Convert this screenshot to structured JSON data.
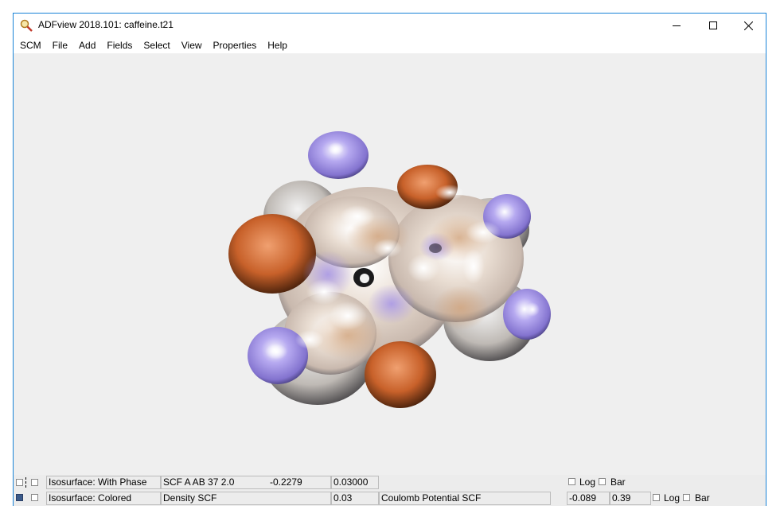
{
  "window": {
    "title": "ADFview 2018.101: caffeine.t21",
    "controls": [
      "minimize",
      "maximize",
      "close"
    ]
  },
  "menu": [
    "SCM",
    "File",
    "Add",
    "Fields",
    "Select",
    "View",
    "Properties",
    "Help"
  ],
  "viewport": {
    "background": "#efefef",
    "object": "caffeine isosurface"
  },
  "status_rows": [
    {
      "type_label": "Isosurface: With Phase",
      "field_label": "SCF A AB 37 2.0",
      "field_value": "-0.2279",
      "iso_value": "0.03000",
      "color_field": "",
      "min_value": "",
      "max_value": "",
      "log_label": "Log",
      "bar_label": "Bar"
    },
    {
      "type_label": "Isosurface: Colored",
      "field_label": "Density SCF",
      "field_value": "",
      "iso_value": "0.03",
      "color_field": "Coulomb Potential SCF",
      "min_value": "-0.089",
      "max_value": "0.39",
      "log_label": "Log",
      "bar_label": "Bar"
    }
  ],
  "colors": {
    "accent_border": "#1883d7",
    "orange_lobe": "#c8612a",
    "purple_lobe": "#9b8ee0",
    "surface_beige": "#d9c0a8"
  }
}
